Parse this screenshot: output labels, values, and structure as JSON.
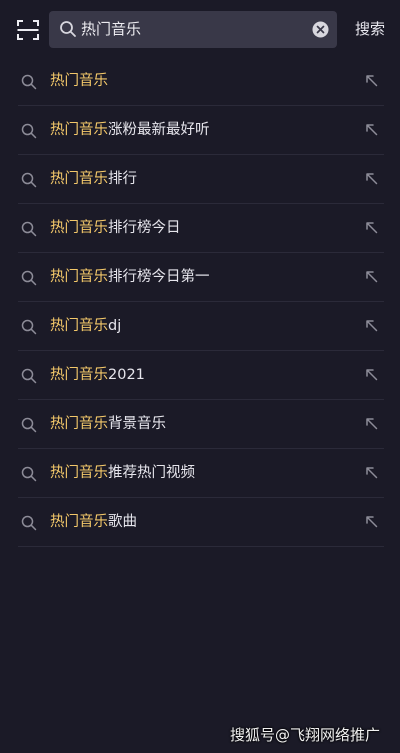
{
  "header": {
    "search_query": "热门音乐",
    "search_button_label": "搜索"
  },
  "suggestions": [
    {
      "keyword": "热门音乐",
      "rest": ""
    },
    {
      "keyword": "热门音乐",
      "rest": "涨粉最新最好听"
    },
    {
      "keyword": "热门音乐",
      "rest": "排行"
    },
    {
      "keyword": "热门音乐",
      "rest": "排行榜今日"
    },
    {
      "keyword": "热门音乐",
      "rest": "排行榜今日第一"
    },
    {
      "keyword": "热门音乐",
      "rest": "dj"
    },
    {
      "keyword": "热门音乐",
      "rest": "2021"
    },
    {
      "keyword": "热门音乐",
      "rest": "背景音乐"
    },
    {
      "keyword": "热门音乐",
      "rest": "推荐热门视频"
    },
    {
      "keyword": "热门音乐",
      "rest": "歌曲"
    }
  ],
  "watermark": "搜狐号@飞翔网络推广",
  "icons": {
    "scan": "scan-icon",
    "search": "search-icon",
    "clear": "clear-icon",
    "fill": "arrow-up-left-icon"
  },
  "colors": {
    "background": "#1b1a27",
    "search_box": "#393848",
    "keyword_highlight": "#f3c86a",
    "text": "#e6e5ec"
  }
}
